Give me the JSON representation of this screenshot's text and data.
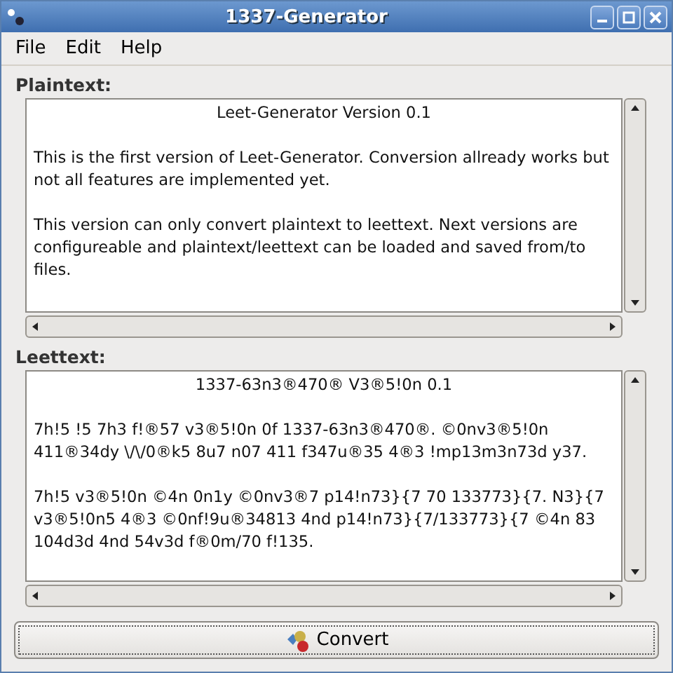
{
  "window": {
    "title": "1337-Generator"
  },
  "menu": [
    {
      "label": "File"
    },
    {
      "label": "Edit"
    },
    {
      "label": "Help"
    }
  ],
  "sections": [
    {
      "label": "Plaintext:",
      "paragraphs": [
        {
          "kind": "heading",
          "lines": [
            "Leet-Generator Version 0.1"
          ]
        },
        {
          "kind": "paragraph",
          "lines": [
            "This is the first version of Leet-Generator. Conversion allready works but",
            "not all features are implemented yet."
          ]
        },
        {
          "kind": "paragraph",
          "lines": [
            "This version can only convert plaintext to leettext. Next versions are",
            "configureable and plaintext/leettext can be loaded and saved from/to",
            "files."
          ]
        }
      ]
    },
    {
      "label": "Leettext:",
      "paragraphs": [
        {
          "kind": "heading",
          "lines": [
            "1337-63n3®470® V3®5!0n 0.1"
          ]
        },
        {
          "kind": "paragraph",
          "lines": [
            "7h!5 !5 7h3 f!®57 v3®5!0n 0f 1337-63n3®470®. ©0nv3®5!0n",
            "411®34dy \\/\\/0®k5 8u7 n07 411 f347u®35 4®3 !mp13m3n73d y37."
          ]
        },
        {
          "kind": "paragraph",
          "lines": [
            "7h!5 v3®5!0n ©4n 0n1y ©0nv3®7 p14!n73}{7 70 133773}{7. N3}{7",
            "v3®5!0n5 4®3 ©0nf!9u®34813 4nd p14!n73}{7/133773}{7 ©4n 83",
            "104d3d 4nd 54v3d f®0m/70 f!135."
          ]
        }
      ]
    }
  ],
  "button": {
    "label": "Convert"
  }
}
